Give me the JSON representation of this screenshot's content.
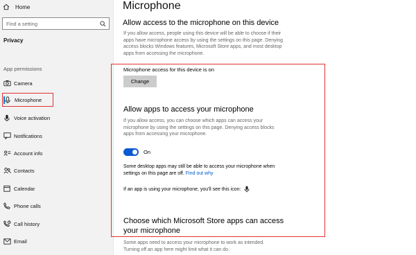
{
  "sidebar": {
    "home_label": "Home",
    "search_placeholder": "Find a setting",
    "section_title": "Privacy",
    "group_title": "App permissions",
    "items": [
      {
        "label": "Camera",
        "icon": "camera-icon"
      },
      {
        "label": "Microphone",
        "icon": "microphone-icon",
        "active": true
      },
      {
        "label": "Voice activation",
        "icon": "voice-activation-icon"
      },
      {
        "label": "Notifications",
        "icon": "notifications-icon"
      },
      {
        "label": "Account info",
        "icon": "account-info-icon"
      },
      {
        "label": "Contacts",
        "icon": "contacts-icon"
      },
      {
        "label": "Calendar",
        "icon": "calendar-icon"
      },
      {
        "label": "Phone calls",
        "icon": "phone-calls-icon"
      },
      {
        "label": "Call history",
        "icon": "call-history-icon"
      },
      {
        "label": "Email",
        "icon": "email-icon"
      }
    ]
  },
  "main": {
    "title": "Microphone",
    "device_access": {
      "heading": "Allow access to the microphone on this device",
      "description": "If you allow access, people using this device will be able to choose if their apps have microphone access by using the settings on this page. Denying access blocks Windows features, Microsoft Store apps, and most desktop apps from accessing the microphone.",
      "status": "Microphone access for this device is on",
      "change_label": "Change"
    },
    "apps_access": {
      "heading": "Allow apps to access your microphone",
      "description": "If you allow access, you can choose which apps can access your microphone by using the settings on this page. Denying access blocks apps from accessing your microphone.",
      "toggle_state": "On",
      "toggle_on": true,
      "note": "Some desktop apps may still be able to access your microphone when settings on this page are off.",
      "note_link": "Find out why",
      "icon_note": "If an app is using your microphone, you'll see this icon:"
    },
    "store_apps": {
      "heading_line1": "Choose which Microsoft Store apps can access",
      "heading_line2": "your microphone",
      "description_line1": "Some apps need to access your microphone to work as intended.",
      "description_line2": "Turning off an app here might limit what it can do."
    }
  },
  "colors": {
    "accent": "#0078d4",
    "toggle": "#0a5bd1",
    "link": "#0058c4",
    "highlight": "#e03131",
    "sidebar_bg": "#f2f2f2",
    "button_bg": "#cccccc"
  }
}
